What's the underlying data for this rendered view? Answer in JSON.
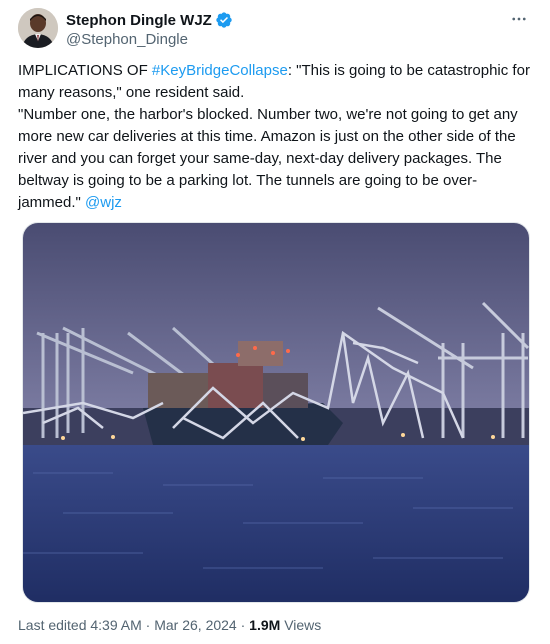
{
  "author": {
    "name": "Stephon Dingle WJZ",
    "handle": "@Stephon_Dingle",
    "verified": true,
    "verified_icon": "verified-badge-icon",
    "verified_color": "#1d9bf0"
  },
  "more_icon": "more-horizontal-icon",
  "tweet": {
    "p1_before": "IMPLICATIONS OF ",
    "p1_hashtag": "#KeyBridgeCollapse",
    "p1_after": ": \"This is going to be catastrophic for many reasons,\" one resident said.",
    "p2": "\"Number one, the harbor's blocked. Number two, we're not going to get any more new car deliveries at this time. Amazon is just on the other side of the river and you can forget your same-day, next-day delivery packages. The beltway is going to be a parking lot. The tunnels are going to be over-jammed.\"",
    "p2_mention": "@wjz",
    "link_color": "#1d9bf0"
  },
  "meta": {
    "edited": "Last edited 4:39 AM",
    "separator": "·",
    "date": "Mar 26, 2024",
    "views_count": "1.9M",
    "views_label": "Views"
  }
}
